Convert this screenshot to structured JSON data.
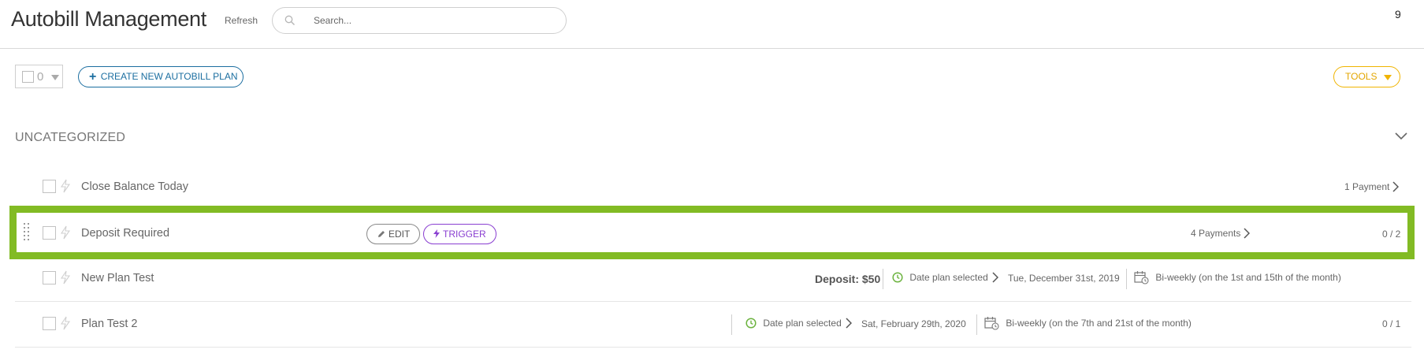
{
  "header": {
    "title": "Autobill Management",
    "refresh_label": "Refresh",
    "search_placeholder": "Search...",
    "corner_count": "9"
  },
  "toolbar": {
    "selected_count": "0",
    "create_label": "CREATE NEW AUTOBILL PLAN",
    "tools_label": "TOOLS"
  },
  "section": {
    "title": "UNCATEGORIZED",
    "rows": [
      {
        "name": "Close Balance Today",
        "payments": "1 Payment"
      },
      {
        "name": "Deposit Required",
        "edit_label": "EDIT",
        "trigger_label": "TRIGGER",
        "payments": "4 Payments",
        "ratio": "0 / 2"
      },
      {
        "name": "New Plan Test",
        "deposit": "Deposit: $50",
        "start_mode": "Date plan selected",
        "start_date": "Tue, December 31st, 2019",
        "schedule": "Bi-weekly (on the 1st and 15th of the month)"
      },
      {
        "name": "Plan Test 2",
        "start_mode": "Date plan selected",
        "start_date": "Sat, February 29th, 2020",
        "schedule": "Bi-weekly (on the 7th and 21st of the month)",
        "ratio": "0 / 1"
      }
    ]
  },
  "colors": {
    "highlight": "#82bb24",
    "primary": "#1b6ea0",
    "tools": "#f0b400",
    "trigger": "#8a3fd1",
    "clock": "#6cb33f"
  },
  "icons": [
    "search-icon",
    "plus-icon",
    "caret-down-icon",
    "chevron-down-icon",
    "bolt-icon",
    "drag-handle-icon",
    "pencil-icon",
    "chevron-right-icon",
    "clock-icon",
    "calendar-icon"
  ]
}
